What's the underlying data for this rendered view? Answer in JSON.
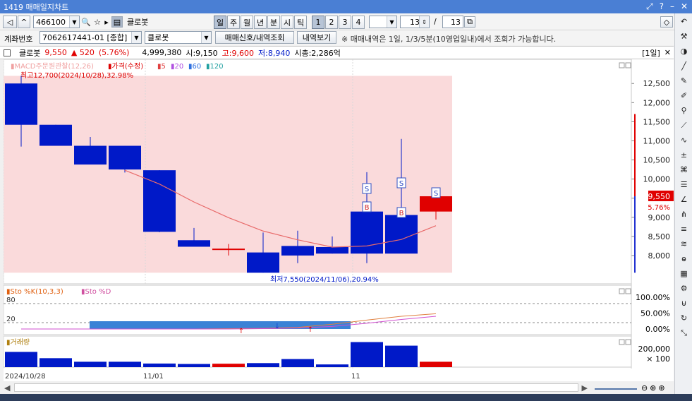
{
  "window": {
    "title": "1419 매매일지차트"
  },
  "toolbar": {
    "stock_code": "466100",
    "stock_name": "클로봇",
    "periods": [
      "일",
      "주",
      "월",
      "년",
      "분",
      "시",
      "틱"
    ],
    "selected_period": "일",
    "numbers": [
      "1",
      "2",
      "3",
      "4"
    ],
    "count1": "1",
    "count2": "13",
    "slash": "/",
    "count3": "13"
  },
  "account": {
    "label": "계좌번호",
    "number": "7062617441-01 [종합]",
    "stock_name": "클로봇",
    "signal_button": "매매신호/내역조회",
    "history_button": "내역보기",
    "notice": "※ 매매내역은 1일, 1/3/5분(10영업일내)에서 조회가 가능합니다."
  },
  "info": {
    "name": "클로봇",
    "price": "9,550",
    "change": "▲ 520",
    "change_pct": "(5.76%)",
    "volume": "4,999,380",
    "open": "시:9,150",
    "high": "고:9,600",
    "low": "저:8,940",
    "mcap": "시총:2,286억",
    "period_badge": "[1일]"
  },
  "legend": {
    "price_prefix": "▮MACD주문원관찰(12,26)",
    "price": "▮가격(수정)",
    "ma5": "▮5",
    "ma20": "▮20",
    "ma60": "▮60",
    "ma120": "▮120",
    "high_note": "최고12,700(2024/10/28),32.98%",
    "low_note": "최저7,550(2024/11/06),20.94%",
    "sto": "▮Sto %K(10,3,3)",
    "sto2": "▮Sto %D",
    "vol": "▮거래량"
  },
  "colors": {
    "up": "#e00000",
    "down": "#0019c8",
    "band": "#fadadb",
    "ma": "#e86a6a"
  },
  "price_axis": {
    "ticks": [
      "12,500",
      "12,000",
      "11,500",
      "11,000",
      "10,500",
      "10,000",
      "9,500",
      "9,000",
      "8,500",
      "8,000"
    ],
    "current": "9,550",
    "current_pct": "5.76%"
  },
  "sto_axis": {
    "ticks": [
      "100.00%",
      "50.00%",
      "0.00%"
    ],
    "lines": [
      "80",
      "20"
    ]
  },
  "vol_axis": {
    "ticks": [
      "200,000",
      "× 100"
    ]
  },
  "x_axis": {
    "labels": [
      "2024/10/28",
      "11/01",
      "11"
    ]
  },
  "markers": {
    "sell": "S",
    "buy": "B"
  },
  "chart_data": {
    "type": "candlestick",
    "x": [
      "2024/10/28",
      "10/29",
      "10/30",
      "10/31",
      "11/01",
      "11/04",
      "11/05",
      "11/06",
      "11/07",
      "11/08",
      "11/11",
      "11/12",
      "11/13"
    ],
    "open": [
      12500,
      11420,
      10870,
      10870,
      10230,
      8400,
      8150,
      8080,
      8250,
      8220,
      9150,
      9060,
      9150
    ],
    "high": [
      12700,
      11420,
      11100,
      10870,
      10230,
      8720,
      8300,
      8600,
      8650,
      8500,
      10180,
      11050,
      9600
    ],
    "low": [
      10850,
      10870,
      10380,
      10170,
      8610,
      8250,
      8000,
      7550,
      7800,
      8050,
      7800,
      8800,
      8940
    ],
    "close": [
      11420,
      10870,
      10380,
      10250,
      8620,
      8230,
      8180,
      7550,
      8000,
      8050,
      8050,
      8050,
      9550
    ],
    "ma5_x": [
      "10/31",
      "11/01",
      "11/04",
      "11/05",
      "11/06",
      "11/07",
      "11/08",
      "11/11",
      "11/12",
      "11/13"
    ],
    "ma5": [
      10230,
      9870,
      9400,
      8990,
      8640,
      8410,
      8220,
      8250,
      8420,
      8780
    ],
    "volume": [
      170000,
      100000,
      60000,
      60000,
      40000,
      35000,
      38000,
      45000,
      90000,
      30000,
      280000,
      240000,
      60000
    ],
    "sto_k": [
      0,
      0,
      0,
      0,
      0,
      0,
      1,
      2,
      5,
      15,
      28,
      40,
      48
    ],
    "sto_d": [
      0,
      0,
      0,
      0,
      0,
      0,
      0,
      1,
      3,
      8,
      18,
      30,
      40
    ],
    "trades": [
      {
        "x": "11/11",
        "type": "buy"
      },
      {
        "x": "11/11",
        "type": "sell"
      },
      {
        "x": "11/12",
        "type": "buy"
      },
      {
        "x": "11/12",
        "type": "sell"
      },
      {
        "x": "11/13",
        "type": "sell"
      }
    ],
    "ylim": [
      7500,
      12800
    ]
  }
}
